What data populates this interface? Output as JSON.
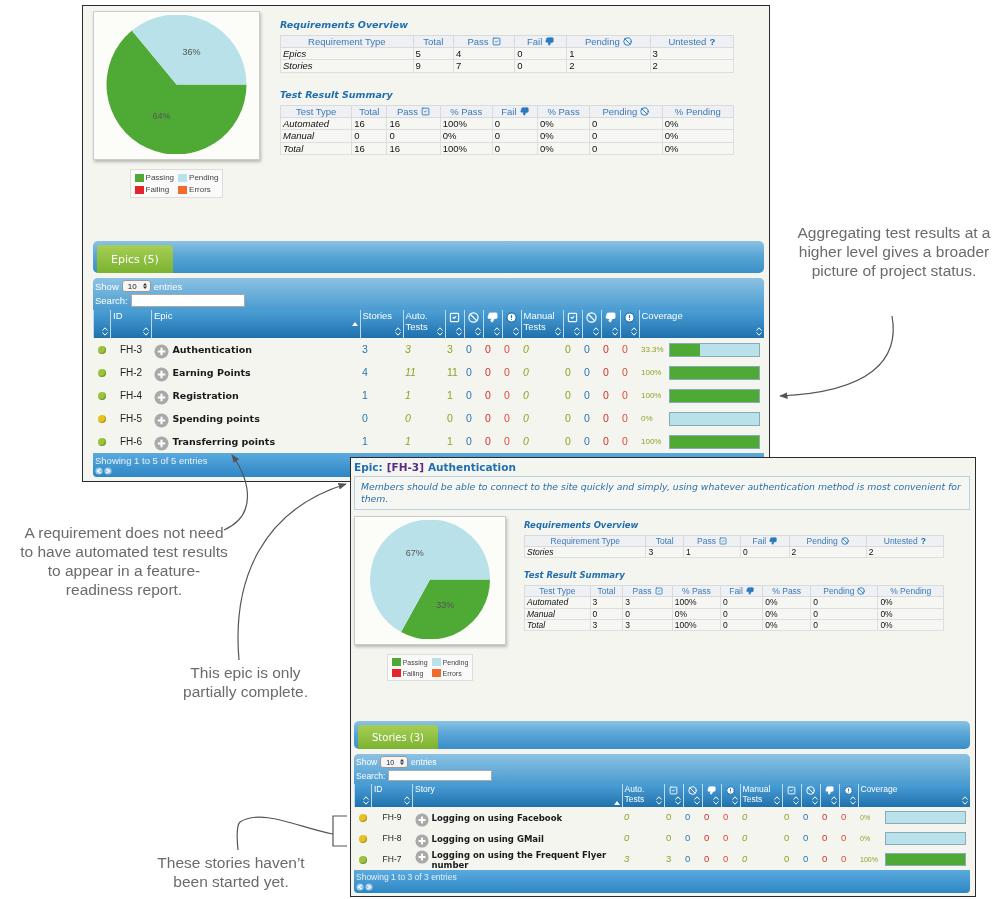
{
  "report": {
    "pie": {
      "chart_data": {
        "type": "pie",
        "values": [
          64,
          36
        ],
        "value_labels": [
          "64%",
          "36%"
        ]
      }
    },
    "legend": [
      {
        "label": "Passing",
        "color": "#4eaa35"
      },
      {
        "label": "Pending",
        "color": "#b9e1e9"
      },
      {
        "label": "Failing",
        "color": "#e3242b"
      },
      {
        "label": "Errors",
        "color": "#f26b2a"
      }
    ],
    "requirements_overview": {
      "title": "Requirements Overview",
      "columns": [
        {
          "label": "Requirement Type",
          "kind": "plain"
        },
        {
          "label": "Total",
          "kind": "plain"
        },
        {
          "label": "Pass",
          "kind": "check"
        },
        {
          "label": "Fail",
          "kind": "thumbs-down"
        },
        {
          "label": "Pending",
          "kind": "blocked"
        },
        {
          "label": "Untested",
          "kind": "symbol",
          "symbol": "?"
        }
      ],
      "rows": [
        [
          "Epics",
          "5",
          "4",
          "0",
          "1",
          "3"
        ],
        [
          "Stories",
          "9",
          "7",
          "0",
          "2",
          "2"
        ]
      ]
    },
    "test_result_summary": {
      "title": "Test Result Summary",
      "columns": [
        {
          "label": "Test Type",
          "kind": "plain"
        },
        {
          "label": "Total",
          "kind": "plain"
        },
        {
          "label": "Pass",
          "kind": "check"
        },
        {
          "label": "% Pass",
          "kind": "plain"
        },
        {
          "label": "Fail",
          "kind": "thumbs-down"
        },
        {
          "label": "% Pass",
          "kind": "plain"
        },
        {
          "label": "Pending",
          "kind": "blocked"
        },
        {
          "label": "% Pending",
          "kind": "plain"
        }
      ],
      "rows": [
        [
          "Automated",
          "16",
          "16",
          "100%",
          "0",
          "0%",
          "0",
          "0%"
        ],
        [
          "Manual",
          "0",
          "0",
          "0%",
          "0",
          "0%",
          "0",
          "0%"
        ],
        [
          "Total",
          "16",
          "16",
          "100%",
          "0",
          "0%",
          "0",
          "0%"
        ]
      ]
    },
    "table_panel": {
      "tab": "Epics (5)",
      "show_label": "Show",
      "page_size": "10",
      "entries_label": "entries",
      "search_label": "Search:",
      "columns": [
        {
          "kind": "status",
          "sorted": false
        },
        {
          "label": "ID",
          "kind": "id",
          "sorted": false
        },
        {
          "label": "Epic",
          "kind": "name",
          "sorted": true
        },
        {
          "label": "Stories",
          "kind": "count",
          "sorted": false
        },
        {
          "label": "Auto. Tests",
          "kind": "tests",
          "sorted": false
        },
        {
          "kind": "check",
          "sorted": false
        },
        {
          "kind": "blocked",
          "sorted": false
        },
        {
          "kind": "thumbs-down",
          "sorted": false
        },
        {
          "kind": "alert",
          "sorted": false
        },
        {
          "label": "Manual Tests",
          "kind": "tests",
          "sorted": false
        },
        {
          "kind": "check",
          "sorted": false
        },
        {
          "kind": "blocked",
          "sorted": false
        },
        {
          "kind": "thumbs-down",
          "sorted": false
        },
        {
          "kind": "alert",
          "sorted": false
        },
        {
          "label": "Coverage",
          "kind": "coverage",
          "sorted": false
        }
      ],
      "rows": [
        {
          "color": "#9cc43a",
          "id": "FH-3",
          "name": "Authentication",
          "values": [
            "3",
            "3",
            "3",
            "0",
            "0",
            "0",
            "0",
            "0",
            "0",
            "0",
            "0"
          ],
          "coverage": "33.3%",
          "level": 0.333
        },
        {
          "color": "#9cc43a",
          "id": "FH-2",
          "name": "Earning Points",
          "values": [
            "4",
            "11",
            "11",
            "0",
            "0",
            "0",
            "0",
            "0",
            "0",
            "0",
            "0"
          ],
          "coverage": "100%",
          "level": 1
        },
        {
          "color": "#9cc43a",
          "id": "FH-4",
          "name": "Registration",
          "values": [
            "1",
            "1",
            "1",
            "0",
            "0",
            "0",
            "0",
            "0",
            "0",
            "0",
            "0"
          ],
          "coverage": "100%",
          "level": 1
        },
        {
          "color": "#e8c320",
          "id": "FH-5",
          "name": "Spending points",
          "values": [
            "0",
            "0",
            "0",
            "0",
            "0",
            "0",
            "0",
            "0",
            "0",
            "0",
            "0"
          ],
          "coverage": "0%",
          "level": 0
        },
        {
          "color": "#9cc43a",
          "id": "FH-6",
          "name": "Transferring points",
          "values": [
            "1",
            "1",
            "1",
            "0",
            "0",
            "0",
            "0",
            "0",
            "0",
            "0",
            "0"
          ],
          "coverage": "100%",
          "level": 1
        }
      ],
      "footer": "Showing 1 to 5 of 5 entries"
    }
  },
  "detail": {
    "title_prefix": "Epic:",
    "title_id": "[FH-3]",
    "title_name": "Authentication",
    "description": "Members should be able to connect to the site quickly and simply, using whatever authentication method is most convenient for them.",
    "pie": {
      "chart_data": {
        "type": "pie",
        "values": [
          33,
          67
        ],
        "value_labels": [
          "33%",
          "67%"
        ]
      }
    },
    "legend": [
      {
        "label": "Passing",
        "color": "#4eaa35"
      },
      {
        "label": "Pending",
        "color": "#b9e1e9"
      },
      {
        "label": "Failing",
        "color": "#e3242b"
      },
      {
        "label": "Errors",
        "color": "#f26b2a"
      }
    ],
    "requirements_overview": {
      "title": "Requirements Overview",
      "columns": [
        {
          "label": "Requirement Type",
          "kind": "plain"
        },
        {
          "label": "Total",
          "kind": "plain"
        },
        {
          "label": "Pass",
          "kind": "check"
        },
        {
          "label": "Fail",
          "kind": "thumbs-down"
        },
        {
          "label": "Pending",
          "kind": "blocked"
        },
        {
          "label": "Untested",
          "kind": "symbol",
          "symbol": "?"
        }
      ],
      "rows": [
        [
          "Stories",
          "3",
          "1",
          "0",
          "2",
          "2"
        ]
      ]
    },
    "test_result_summary": {
      "title": "Test Result Summary",
      "columns": [
        {
          "label": "Test Type",
          "kind": "plain"
        },
        {
          "label": "Total",
          "kind": "plain"
        },
        {
          "label": "Pass",
          "kind": "check"
        },
        {
          "label": "% Pass",
          "kind": "plain"
        },
        {
          "label": "Fail",
          "kind": "thumbs-down"
        },
        {
          "label": "% Pass",
          "kind": "plain"
        },
        {
          "label": "Pending",
          "kind": "blocked"
        },
        {
          "label": "% Pending",
          "kind": "plain"
        }
      ],
      "rows": [
        [
          "Automated",
          "3",
          "3",
          "100%",
          "0",
          "0%",
          "0",
          "0%"
        ],
        [
          "Manual",
          "0",
          "0",
          "0%",
          "0",
          "0%",
          "0",
          "0%"
        ],
        [
          "Total",
          "3",
          "3",
          "100%",
          "0",
          "0%",
          "0",
          "0%"
        ]
      ]
    },
    "table_panel": {
      "tab": "Stories (3)",
      "show_label": "Show",
      "page_size": "10",
      "entries_label": "entries",
      "search_label": "Search:",
      "columns": [
        {
          "kind": "status",
          "sorted": false
        },
        {
          "label": "ID",
          "kind": "id",
          "sorted": false
        },
        {
          "label": "Story",
          "kind": "name",
          "sorted": true
        },
        {
          "label": "Auto. Tests",
          "kind": "tests",
          "sorted": false
        },
        {
          "kind": "check",
          "sorted": false
        },
        {
          "kind": "blocked",
          "sorted": false
        },
        {
          "kind": "thumbs-down",
          "sorted": false
        },
        {
          "kind": "alert",
          "sorted": false
        },
        {
          "label": "Manual Tests",
          "kind": "tests",
          "sorted": false
        },
        {
          "kind": "check",
          "sorted": false
        },
        {
          "kind": "blocked",
          "sorted": false
        },
        {
          "kind": "thumbs-down",
          "sorted": false
        },
        {
          "kind": "alert",
          "sorted": false
        },
        {
          "label": "Coverage",
          "kind": "coverage",
          "sorted": false
        }
      ],
      "rows": [
        {
          "color": "#e8c320",
          "id": "FH-9",
          "name": "Logging on using Facebook",
          "values": [
            "0",
            "0",
            "0",
            "0",
            "0",
            "0",
            "0",
            "0",
            "0",
            "0"
          ],
          "coverage": "0%",
          "level": 0
        },
        {
          "color": "#e8c320",
          "id": "FH-8",
          "name": "Logging on using GMail",
          "values": [
            "0",
            "0",
            "0",
            "0",
            "0",
            "0",
            "0",
            "0",
            "0",
            "0"
          ],
          "coverage": "0%",
          "level": 0
        },
        {
          "color": "#9cc43a",
          "id": "FH-7",
          "name": "Logging on using the Frequent Flyer number",
          "values": [
            "3",
            "3",
            "0",
            "0",
            "0",
            "0",
            "0",
            "0",
            "0",
            "0"
          ],
          "coverage": "100%",
          "level": 1
        }
      ],
      "footer": "Showing 1 to 3 of 3 entries"
    }
  },
  "callouts": [
    {
      "text": "Aggregating test results at a higher level gives a broader picture of project status."
    },
    {
      "text": "A requirement does not need to have automated test results to appear in a feature-readiness report."
    },
    {
      "text": "This epic is only partially complete."
    },
    {
      "text": "These stories haven’t been started yet."
    }
  ]
}
